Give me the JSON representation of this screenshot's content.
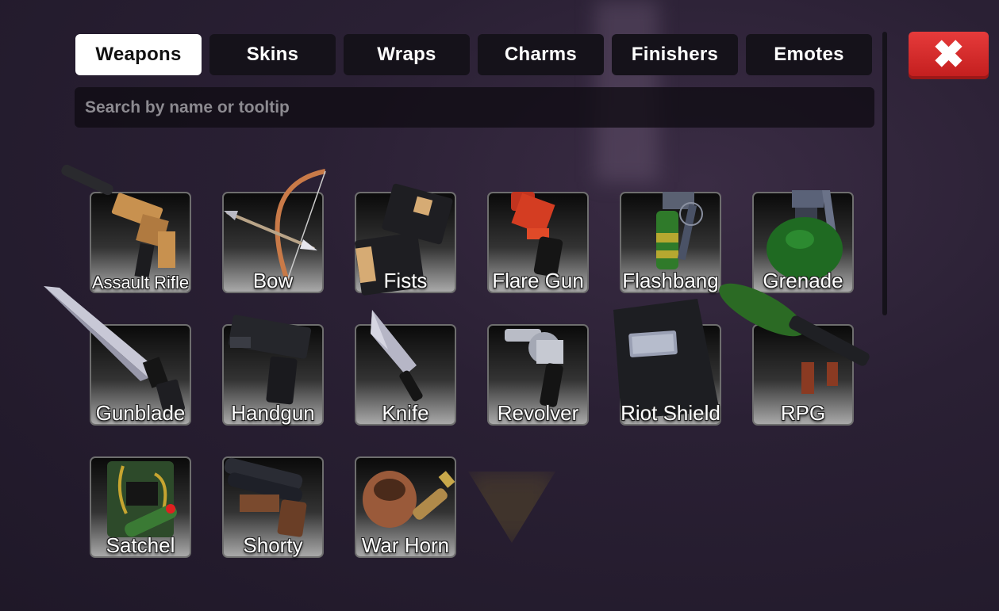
{
  "tabs": [
    {
      "label": "Weapons",
      "active": true
    },
    {
      "label": "Skins",
      "active": false
    },
    {
      "label": "Wraps",
      "active": false
    },
    {
      "label": "Charms",
      "active": false
    },
    {
      "label": "Finishers",
      "active": false
    },
    {
      "label": "Emotes",
      "active": false
    }
  ],
  "close": {
    "icon": "close-icon",
    "symbol": "✖",
    "color": "#d62a2a"
  },
  "search": {
    "placeholder": "Search by name or tooltip",
    "value": ""
  },
  "items": [
    {
      "label": "Assault Rifle",
      "icon": "assault-rifle-icon"
    },
    {
      "label": "Bow",
      "icon": "bow-icon"
    },
    {
      "label": "Fists",
      "icon": "fists-icon"
    },
    {
      "label": "Flare Gun",
      "icon": "flare-gun-icon"
    },
    {
      "label": "Flashbang",
      "icon": "flashbang-icon"
    },
    {
      "label": "Grenade",
      "icon": "grenade-icon"
    },
    {
      "label": "Gunblade",
      "icon": "gunblade-icon"
    },
    {
      "label": "Handgun",
      "icon": "handgun-icon"
    },
    {
      "label": "Knife",
      "icon": "knife-icon"
    },
    {
      "label": "Revolver",
      "icon": "revolver-icon"
    },
    {
      "label": "Riot Shield",
      "icon": "riot-shield-icon"
    },
    {
      "label": "RPG",
      "icon": "rpg-icon"
    },
    {
      "label": "Satchel",
      "icon": "satchel-icon"
    },
    {
      "label": "Shorty",
      "icon": "shorty-icon"
    },
    {
      "label": "War Horn",
      "icon": "war-horn-icon"
    }
  ]
}
